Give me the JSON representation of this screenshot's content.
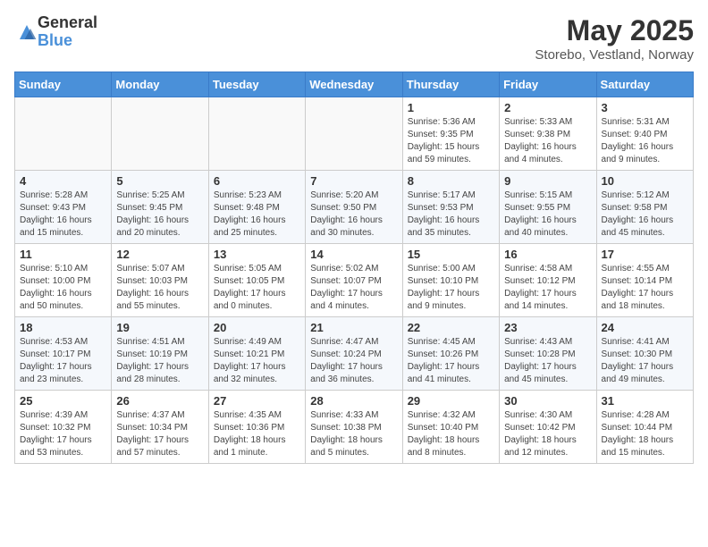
{
  "header": {
    "logo_general": "General",
    "logo_blue": "Blue",
    "month_title": "May 2025",
    "location": "Storebo, Vestland, Norway"
  },
  "days_of_week": [
    "Sunday",
    "Monday",
    "Tuesday",
    "Wednesday",
    "Thursday",
    "Friday",
    "Saturday"
  ],
  "weeks": [
    [
      {
        "day": "",
        "info": ""
      },
      {
        "day": "",
        "info": ""
      },
      {
        "day": "",
        "info": ""
      },
      {
        "day": "",
        "info": ""
      },
      {
        "day": "1",
        "info": "Sunrise: 5:36 AM\nSunset: 9:35 PM\nDaylight: 15 hours and 59 minutes."
      },
      {
        "day": "2",
        "info": "Sunrise: 5:33 AM\nSunset: 9:38 PM\nDaylight: 16 hours and 4 minutes."
      },
      {
        "day": "3",
        "info": "Sunrise: 5:31 AM\nSunset: 9:40 PM\nDaylight: 16 hours and 9 minutes."
      }
    ],
    [
      {
        "day": "4",
        "info": "Sunrise: 5:28 AM\nSunset: 9:43 PM\nDaylight: 16 hours and 15 minutes."
      },
      {
        "day": "5",
        "info": "Sunrise: 5:25 AM\nSunset: 9:45 PM\nDaylight: 16 hours and 20 minutes."
      },
      {
        "day": "6",
        "info": "Sunrise: 5:23 AM\nSunset: 9:48 PM\nDaylight: 16 hours and 25 minutes."
      },
      {
        "day": "7",
        "info": "Sunrise: 5:20 AM\nSunset: 9:50 PM\nDaylight: 16 hours and 30 minutes."
      },
      {
        "day": "8",
        "info": "Sunrise: 5:17 AM\nSunset: 9:53 PM\nDaylight: 16 hours and 35 minutes."
      },
      {
        "day": "9",
        "info": "Sunrise: 5:15 AM\nSunset: 9:55 PM\nDaylight: 16 hours and 40 minutes."
      },
      {
        "day": "10",
        "info": "Sunrise: 5:12 AM\nSunset: 9:58 PM\nDaylight: 16 hours and 45 minutes."
      }
    ],
    [
      {
        "day": "11",
        "info": "Sunrise: 5:10 AM\nSunset: 10:00 PM\nDaylight: 16 hours and 50 minutes."
      },
      {
        "day": "12",
        "info": "Sunrise: 5:07 AM\nSunset: 10:03 PM\nDaylight: 16 hours and 55 minutes."
      },
      {
        "day": "13",
        "info": "Sunrise: 5:05 AM\nSunset: 10:05 PM\nDaylight: 17 hours and 0 minutes."
      },
      {
        "day": "14",
        "info": "Sunrise: 5:02 AM\nSunset: 10:07 PM\nDaylight: 17 hours and 4 minutes."
      },
      {
        "day": "15",
        "info": "Sunrise: 5:00 AM\nSunset: 10:10 PM\nDaylight: 17 hours and 9 minutes."
      },
      {
        "day": "16",
        "info": "Sunrise: 4:58 AM\nSunset: 10:12 PM\nDaylight: 17 hours and 14 minutes."
      },
      {
        "day": "17",
        "info": "Sunrise: 4:55 AM\nSunset: 10:14 PM\nDaylight: 17 hours and 18 minutes."
      }
    ],
    [
      {
        "day": "18",
        "info": "Sunrise: 4:53 AM\nSunset: 10:17 PM\nDaylight: 17 hours and 23 minutes."
      },
      {
        "day": "19",
        "info": "Sunrise: 4:51 AM\nSunset: 10:19 PM\nDaylight: 17 hours and 28 minutes."
      },
      {
        "day": "20",
        "info": "Sunrise: 4:49 AM\nSunset: 10:21 PM\nDaylight: 17 hours and 32 minutes."
      },
      {
        "day": "21",
        "info": "Sunrise: 4:47 AM\nSunset: 10:24 PM\nDaylight: 17 hours and 36 minutes."
      },
      {
        "day": "22",
        "info": "Sunrise: 4:45 AM\nSunset: 10:26 PM\nDaylight: 17 hours and 41 minutes."
      },
      {
        "day": "23",
        "info": "Sunrise: 4:43 AM\nSunset: 10:28 PM\nDaylight: 17 hours and 45 minutes."
      },
      {
        "day": "24",
        "info": "Sunrise: 4:41 AM\nSunset: 10:30 PM\nDaylight: 17 hours and 49 minutes."
      }
    ],
    [
      {
        "day": "25",
        "info": "Sunrise: 4:39 AM\nSunset: 10:32 PM\nDaylight: 17 hours and 53 minutes."
      },
      {
        "day": "26",
        "info": "Sunrise: 4:37 AM\nSunset: 10:34 PM\nDaylight: 17 hours and 57 minutes."
      },
      {
        "day": "27",
        "info": "Sunrise: 4:35 AM\nSunset: 10:36 PM\nDaylight: 18 hours and 1 minute."
      },
      {
        "day": "28",
        "info": "Sunrise: 4:33 AM\nSunset: 10:38 PM\nDaylight: 18 hours and 5 minutes."
      },
      {
        "day": "29",
        "info": "Sunrise: 4:32 AM\nSunset: 10:40 PM\nDaylight: 18 hours and 8 minutes."
      },
      {
        "day": "30",
        "info": "Sunrise: 4:30 AM\nSunset: 10:42 PM\nDaylight: 18 hours and 12 minutes."
      },
      {
        "day": "31",
        "info": "Sunrise: 4:28 AM\nSunset: 10:44 PM\nDaylight: 18 hours and 15 minutes."
      }
    ]
  ]
}
